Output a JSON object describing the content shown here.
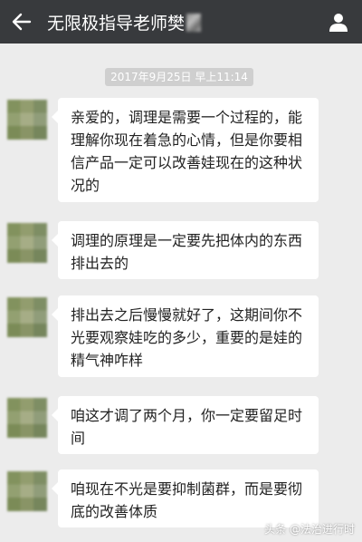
{
  "header": {
    "title": "无限极指导老师樊",
    "back_icon": "back-arrow-icon",
    "profile_icon": "person-icon"
  },
  "timestamp": "2017年9月25日 早上11:14",
  "messages": [
    {
      "text": "亲爱的，调理是需要一个过程的，能理解你现在着急的心情，但是你要相信产品一定可以改善娃现在的这种状况的"
    },
    {
      "text": "调理的原理是一定要先把体内的东西排出去的"
    },
    {
      "text": "排出去之后慢慢就好了，这期间你不光要观察娃吃的多少，重要的是娃的精气神咋样"
    },
    {
      "text": "咱这才调了两个月，你一定要留足时间"
    },
    {
      "text": "咱现在不光是要抑制菌群，而是要彻底的改善体质"
    }
  ],
  "watermark": "头条 @法治进行时"
}
